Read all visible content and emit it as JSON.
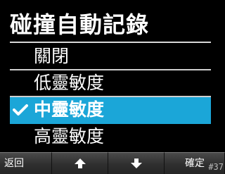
{
  "screen_title": "碰撞自動記錄",
  "options": [
    {
      "label": "關閉",
      "selected": false
    },
    {
      "label": "低靈敏度",
      "selected": false
    },
    {
      "label": "中靈敏度",
      "selected": true
    },
    {
      "label": "高靈敏度",
      "selected": false
    }
  ],
  "softkeys": {
    "back_label": "返回",
    "up_icon": "arrow-up-icon",
    "down_icon": "arrow-down-icon",
    "confirm_label": "確定"
  },
  "selection_color": "#1ba6d8",
  "watermark": "#37"
}
